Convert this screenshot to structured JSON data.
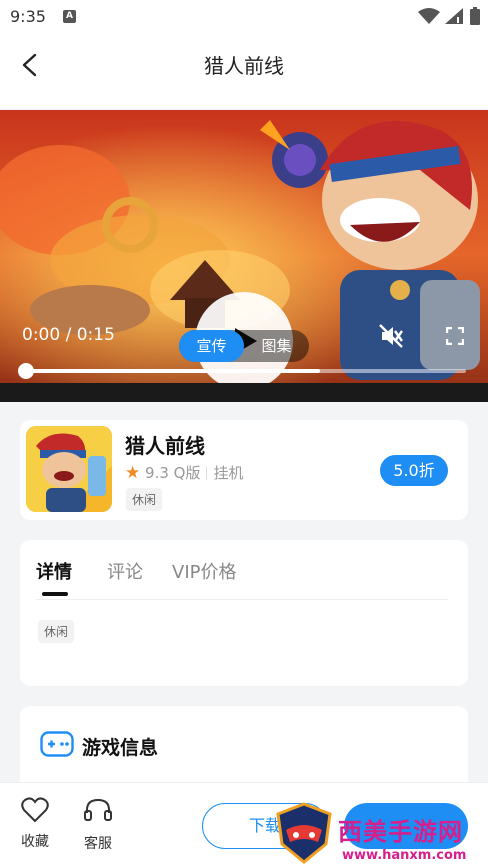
{
  "status_bar": {
    "time": "9:35",
    "notification_icon": "A"
  },
  "header": {
    "title": "猎人前线"
  },
  "video": {
    "time_label": "0:00 / 0:15",
    "segments": [
      "宣传",
      "图集"
    ],
    "active_segment": "宣传",
    "progress": 0.67,
    "muted": true
  },
  "game": {
    "name": "猎人前线",
    "rating": "9.3",
    "version": "Q版",
    "type": "挂机",
    "tag": "休闲",
    "discount": "5.0折"
  },
  "detail": {
    "tabs": [
      "详情",
      "评论",
      "VIP价格"
    ],
    "active_tab": "详情",
    "tag": "休闲"
  },
  "info": {
    "title": "游戏信息"
  },
  "bottom_bar": {
    "favorite_label": "收藏",
    "service_label": "客服",
    "download_label": "下载",
    "primary_label": ""
  },
  "watermark": {
    "text": "西美手游网",
    "url": "www.hanxm.com"
  },
  "colors": {
    "accent": "#1e8ef5",
    "star": "#f08a24",
    "watermark": "#d41f8c"
  }
}
